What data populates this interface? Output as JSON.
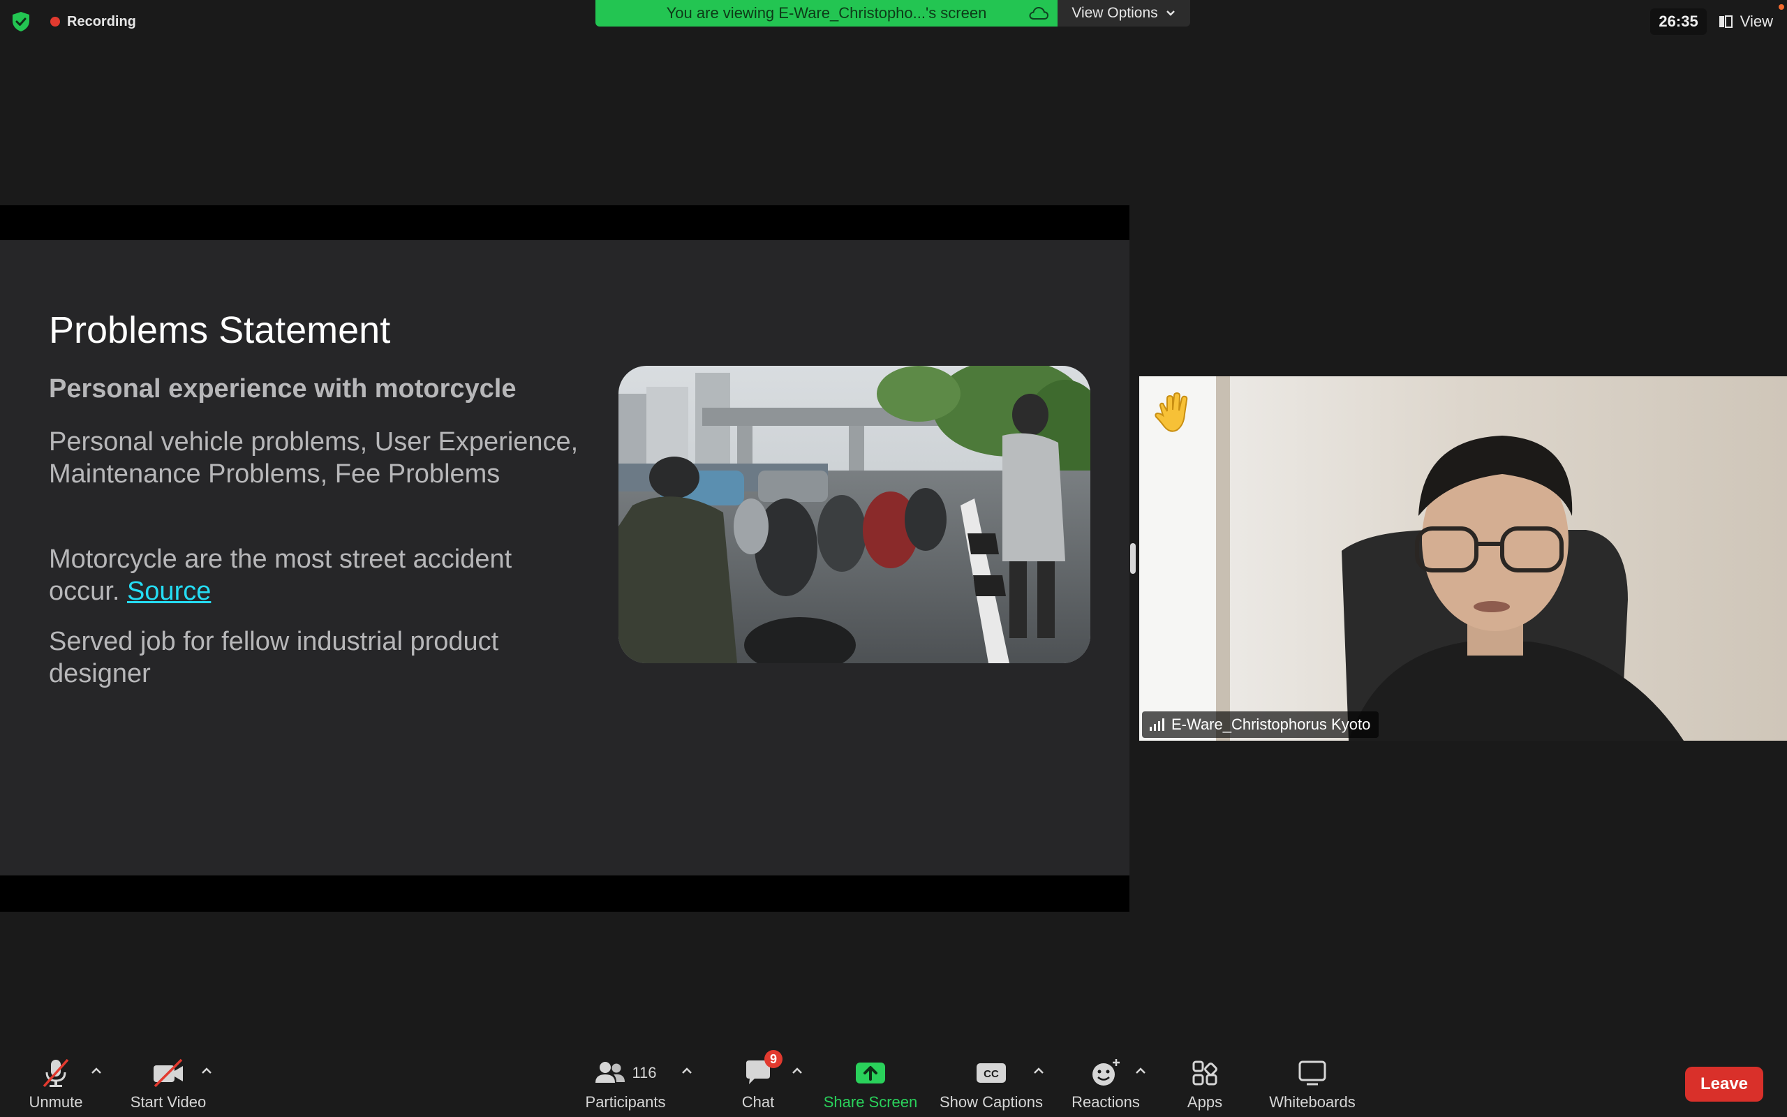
{
  "top_bar": {
    "recording_label": "Recording",
    "viewing_banner": "You are viewing E-Ware_Christopho...'s screen",
    "view_options_label": "View Options",
    "timer": "26:35",
    "view_label": "View"
  },
  "slide": {
    "title": "Problems Statement",
    "subtitle": "Personal experience with motorcycle",
    "para1": "Personal vehicle problems, User Experience, Maintenance Problems, Fee Problems",
    "para2_text": "Motorcycle are the most street accident occur. ",
    "para2_link": "Source",
    "para3": "Served job for fellow industrial product designer"
  },
  "participant": {
    "name": "E-Ware_Christophorus Kyoto"
  },
  "toolbar": {
    "unmute_label": "Unmute",
    "start_video_label": "Start Video",
    "participants_label": "Participants",
    "participants_count": "116",
    "chat_label": "Chat",
    "chat_badge": "9",
    "share_screen_label": "Share Screen",
    "show_captions_label": "Show Captions",
    "cc_text": "CC",
    "reactions_label": "Reactions",
    "apps_label": "Apps",
    "whiteboards_label": "Whiteboards",
    "leave_label": "Leave"
  },
  "colors": {
    "banner_green": "#23c552",
    "share_green": "#2ad15b",
    "leave_red": "#d9302a",
    "link_cyan": "#25dcf3"
  }
}
